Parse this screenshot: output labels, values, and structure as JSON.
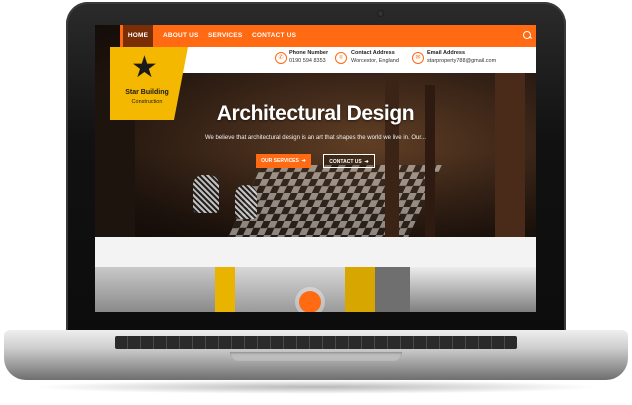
{
  "nav": {
    "items": [
      "HOME",
      "ABOUT US",
      "SERVICES",
      "CONTACT US"
    ],
    "search_icon": "search-icon"
  },
  "logo": {
    "name": "Star Building",
    "tagline": "Construction",
    "star_glyph": "★"
  },
  "contacts": [
    {
      "label": "Phone Number",
      "value": "0190 594 8353",
      "icon": "phone-icon"
    },
    {
      "label": "Contact Address",
      "value": "Worcestor, England",
      "icon": "location-icon"
    },
    {
      "label": "Email Address",
      "value": "starproperty788@gmail.com",
      "icon": "mail-icon"
    }
  ],
  "hero": {
    "title": "Architectural Design",
    "subtitle": "We believe that architectural design is an art that shapes the world we live in. Our...",
    "buttons": [
      "OUR SERVICES",
      "CONTACT US"
    ]
  },
  "colors": {
    "accent": "#ff6a13",
    "nav_active": "#7a2e05",
    "logo_bg": "#f5b800"
  }
}
